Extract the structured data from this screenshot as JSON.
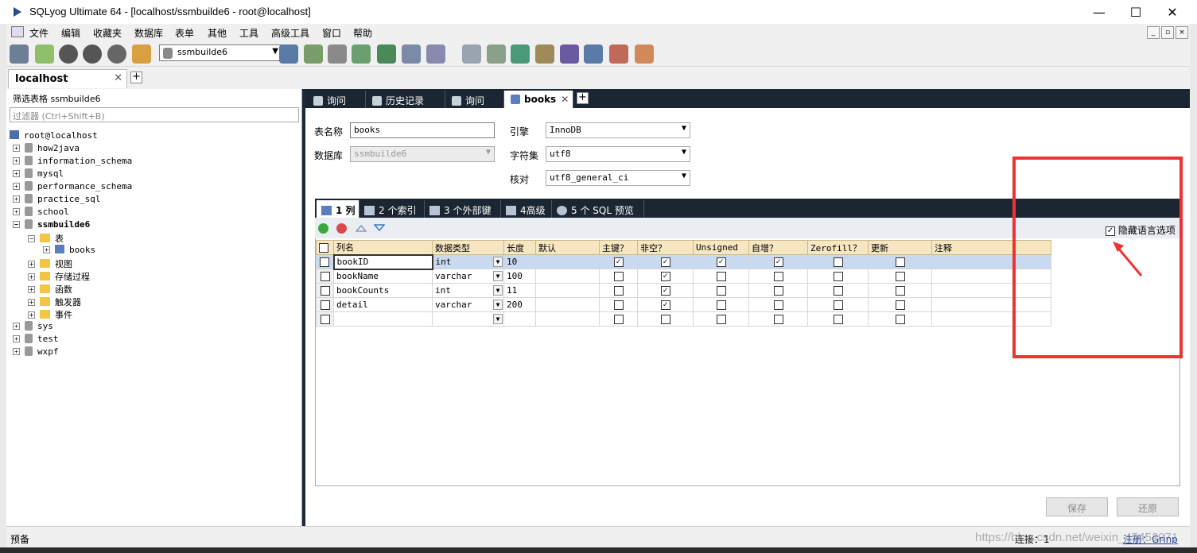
{
  "window": {
    "title": "SQLyog Ultimate 64 - [localhost/ssmbuilde6 - root@localhost]",
    "minimize": "—",
    "maximize": "☐",
    "close": "✕"
  },
  "menu": [
    "文件",
    "编辑",
    "收藏夹",
    "数据库",
    "表单",
    "其他",
    "工具",
    "高级工具",
    "窗口",
    "帮助"
  ],
  "toolbar": {
    "db_select": "ssmbuilde6"
  },
  "connection_tab": {
    "label": "localhost",
    "close": "✕",
    "add": "+"
  },
  "sidebar": {
    "filter_label": "筛选表格 ssmbuilde6",
    "filter_placeholder": "过滤器 (Ctrl+Shift+B)",
    "root": "root@localhost",
    "databases": [
      "how2java",
      "information_schema",
      "mysql",
      "performance_schema",
      "practice_sql",
      "school"
    ],
    "active_db": "ssmbuilde6",
    "tables_folder": "表",
    "table": "books",
    "folders": [
      "视图",
      "存储过程",
      "函数",
      "触发器",
      "事件"
    ],
    "more_databases": [
      "sys",
      "test",
      "wxpf"
    ]
  },
  "query_tabs": [
    {
      "label": "询问"
    },
    {
      "label": "历史记录"
    },
    {
      "label": "询问"
    },
    {
      "label": "books",
      "close": "✕"
    }
  ],
  "query_tabs_add": "+",
  "form": {
    "table_name_label": "表名称",
    "table_name_value": "books",
    "database_label": "数据库",
    "database_value": "ssmbuilde6",
    "engine_label": "引擎",
    "engine_value": "InnoDB",
    "charset_label": "字符集",
    "charset_value": "utf8",
    "collation_label": "核对",
    "collation_value": "utf8_general_ci"
  },
  "sub_tabs": [
    "1 列",
    "2 个索引",
    "3 个外部键",
    "4高级",
    "5 个 SQL 预览"
  ],
  "hide_language_options": {
    "label": "隐藏语言选项",
    "checked": true
  },
  "grid": {
    "headers": [
      "列名",
      "数据类型",
      "长度",
      "默认",
      "主键？",
      "非空？",
      "Unsigned",
      "自增？",
      "Zerofill？",
      "更新",
      "注释"
    ],
    "rows": [
      {
        "name": "bookID",
        "type": "int",
        "length": "10",
        "default": "",
        "pk": true,
        "notnull": true,
        "unsigned": true,
        "autoinc": true,
        "zerofill": false,
        "update": false,
        "comment": ""
      },
      {
        "name": "bookName",
        "type": "varchar",
        "length": "100",
        "default": "",
        "pk": false,
        "notnull": true,
        "unsigned": false,
        "autoinc": false,
        "zerofill": false,
        "update": false,
        "comment": ""
      },
      {
        "name": "bookCounts",
        "type": "int",
        "length": "11",
        "default": "",
        "pk": false,
        "notnull": true,
        "unsigned": false,
        "autoinc": false,
        "zerofill": false,
        "update": false,
        "comment": ""
      },
      {
        "name": "detail",
        "type": "varchar",
        "length": "200",
        "default": "",
        "pk": false,
        "notnull": true,
        "unsigned": false,
        "autoinc": false,
        "zerofill": false,
        "update": false,
        "comment": ""
      },
      {
        "name": "",
        "type": "",
        "length": "",
        "default": "",
        "pk": false,
        "notnull": false,
        "unsigned": false,
        "autoinc": false,
        "zerofill": false,
        "update": false,
        "comment": ""
      }
    ]
  },
  "buttons": {
    "save": "保存",
    "revert": "还原"
  },
  "status": {
    "left": "预备",
    "connection": "连接：1",
    "register": "注册：Grinp"
  },
  "watermark": "https://blog.csdn.net/weixin_45452071",
  "colors": {
    "tab_bar": "#1c2633",
    "grid_header": "#f6e7c1",
    "selected_row": "#c8d9f0",
    "annotation": "#ee3333"
  }
}
